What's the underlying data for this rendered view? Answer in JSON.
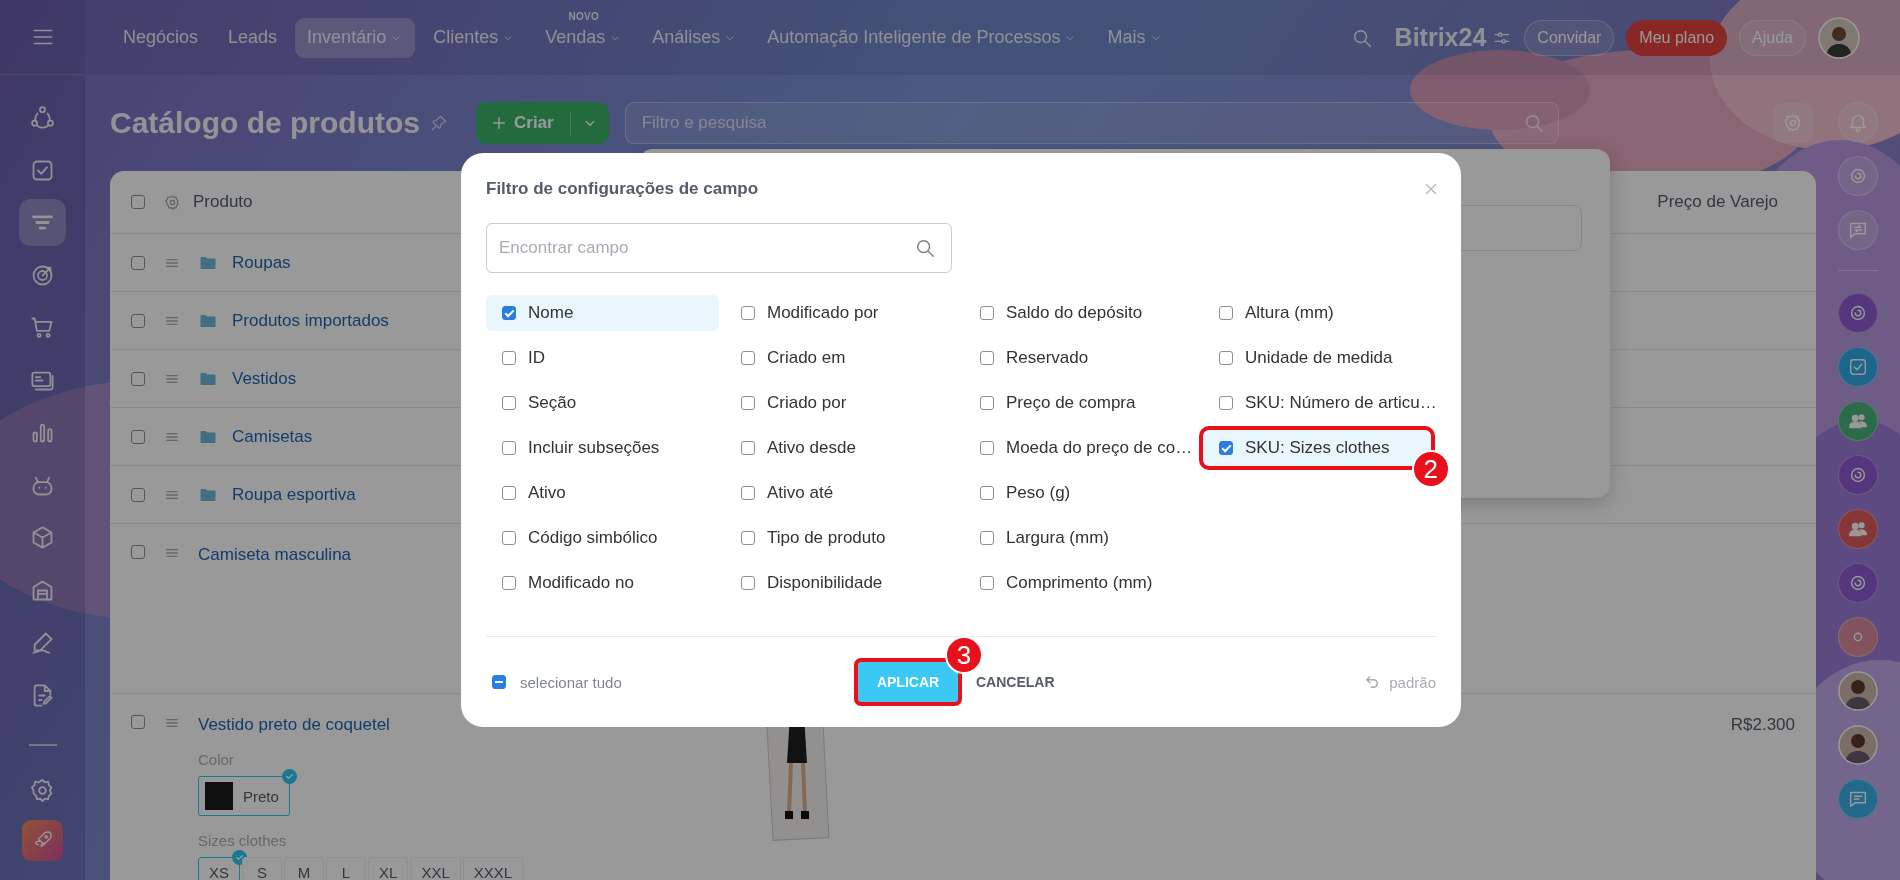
{
  "top_nav": {
    "items": [
      {
        "label": "Negócios",
        "selected": false,
        "dropdown": false
      },
      {
        "label": "Leads",
        "selected": false,
        "dropdown": false
      },
      {
        "label": "Inventário",
        "selected": true,
        "dropdown": true
      },
      {
        "label": "Clientes",
        "selected": false,
        "dropdown": true
      },
      {
        "label": "Vendas",
        "selected": false,
        "dropdown": true,
        "badge": "NOVO"
      },
      {
        "label": "Análises",
        "selected": false,
        "dropdown": true
      },
      {
        "label": "Automação Inteligente de Processos",
        "selected": false,
        "dropdown": true
      },
      {
        "label": "Mais",
        "selected": false,
        "dropdown": true
      }
    ],
    "brand": "Bitrix24",
    "buttons": [
      {
        "label": "Convidar",
        "kind": "outline"
      },
      {
        "label": "Meu plano",
        "kind": "accent"
      },
      {
        "label": "Ajuda",
        "kind": "outline"
      }
    ]
  },
  "left_sidebar": {
    "items": [
      {
        "selected": false
      },
      {
        "selected": false
      },
      {
        "selected": true
      },
      {
        "selected": false
      },
      {
        "selected": false
      },
      {
        "selected": false
      },
      {
        "selected": false
      },
      {
        "selected": false
      },
      {
        "selected": false
      },
      {
        "selected": false
      },
      {
        "selected": false
      },
      {
        "selected": false
      }
    ],
    "bottom_items": [
      {
        "selected": false
      },
      {
        "selected": false
      }
    ]
  },
  "page": {
    "title": "Catálogo de produtos",
    "create_button": "Criar",
    "search": {
      "placeholder": "Filtro e pesquisa"
    }
  },
  "grid": {
    "header_checked": false,
    "columns": [
      "Produto",
      "Preço de Varejo"
    ],
    "rows": [
      {
        "kind": "folder",
        "name": "Roupas",
        "checked": false
      },
      {
        "kind": "folder",
        "name": "Produtos importados",
        "checked": false
      },
      {
        "kind": "folder",
        "name": "Vestidos",
        "checked": false
      },
      {
        "kind": "folder",
        "name": "Camisetas",
        "checked": false
      },
      {
        "kind": "folder",
        "name": "Roupa esportiva",
        "checked": false
      },
      {
        "kind": "product",
        "name": "Camiseta masculina",
        "checked": false
      },
      {
        "kind": "product",
        "name": "Vestido preto de coquetel",
        "checked": false,
        "price": "R$2.300",
        "image": {
          "kind": "picture"
        },
        "properties": [
          {
            "label": "Color",
            "kind": "swatch",
            "options": [
              {
                "label": "Preto",
                "color": "#1c1c1c",
                "selected": true
              }
            ]
          },
          {
            "label": "Sizes clothes",
            "kind": "text",
            "options": [
              {
                "label": "XS",
                "selected": true
              },
              {
                "label": "S",
                "selected": false
              },
              {
                "label": "M",
                "selected": false
              },
              {
                "label": "L",
                "selected": false
              },
              {
                "label": "XL",
                "selected": false
              },
              {
                "label": "XXL",
                "selected": false
              },
              {
                "label": "XXXL",
                "selected": false
              }
            ]
          }
        ]
      }
    ]
  },
  "modal": {
    "title": "Filtro de configurações de campo",
    "search": {
      "placeholder": "Encontrar campo"
    },
    "field_columns": [
      {
        "fields": [
          {
            "label": "Nome",
            "checked": true
          },
          {
            "label": "ID",
            "checked": false
          },
          {
            "label": "Seção",
            "checked": false
          },
          {
            "label": "Incluir subseções",
            "checked": false
          },
          {
            "label": "Ativo",
            "checked": false
          },
          {
            "label": "Código simbólico",
            "checked": false
          },
          {
            "label": "Modificado no",
            "checked": false
          }
        ]
      },
      {
        "fields": [
          {
            "label": "Modificado por",
            "checked": false
          },
          {
            "label": "Criado em",
            "checked": false
          },
          {
            "label": "Criado por",
            "checked": false
          },
          {
            "label": "Ativo desde",
            "checked": false
          },
          {
            "label": "Ativo até",
            "checked": false
          },
          {
            "label": "Tipo de produto",
            "checked": false
          },
          {
            "label": "Disponibilidade",
            "checked": false
          }
        ]
      },
      {
        "fields": [
          {
            "label": "Saldo do depósito",
            "checked": false
          },
          {
            "label": "Reservado",
            "checked": false
          },
          {
            "label": "Preço de compra",
            "checked": false
          },
          {
            "label": "Moeda do preço de co…",
            "checked": false
          },
          {
            "label": "Peso (g)",
            "checked": false
          },
          {
            "label": "Largura (mm)",
            "checked": false
          },
          {
            "label": "Comprimento (mm)",
            "checked": false
          }
        ]
      },
      {
        "fields": [
          {
            "label": "Altura (mm)",
            "checked": false
          },
          {
            "label": "Unidade de medida",
            "checked": false
          },
          {
            "label": "SKU: Número de articu…",
            "checked": false
          },
          {
            "label": "SKU: Sizes clothes",
            "checked": true,
            "annotation": "2"
          }
        ]
      }
    ],
    "select_all": {
      "label": "selecionar tudo",
      "indeterminate": true
    },
    "apply_button": {
      "label": "APLICAR",
      "annotation": "3"
    },
    "cancel_button": "CANCELAR",
    "reset_button": "padrão"
  }
}
